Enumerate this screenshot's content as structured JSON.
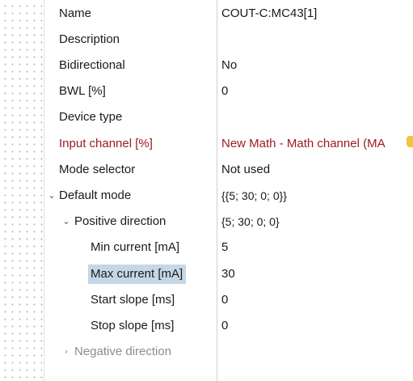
{
  "properties": [
    {
      "name": "Name",
      "value": "COUT-C:MC43[1]"
    },
    {
      "name": "Description",
      "value": ""
    },
    {
      "name": "Bidirectional",
      "value": "No"
    },
    {
      "name": "BWL [%]",
      "value": "0"
    },
    {
      "name": "Device type",
      "value": ""
    },
    {
      "name": "Input channel [%]",
      "value": "New Math - Math channel (MA"
    },
    {
      "name": "Mode selector",
      "value": "Not used"
    },
    {
      "name": "Default mode",
      "value": "{{5; 30; 0; 0}}"
    },
    {
      "name": "Positive direction",
      "value": "{5; 30; 0; 0}"
    },
    {
      "name": "Min current [mA]",
      "value": "5"
    },
    {
      "name": "Max current [mA]",
      "value": "30"
    },
    {
      "name": "Start slope [ms]",
      "value": "0"
    },
    {
      "name": "Stop slope [ms]",
      "value": "0"
    },
    {
      "name": "Negative direction",
      "value": ""
    }
  ],
  "selected_row": "Max current [mA]",
  "colors": {
    "error_text": "#9b1b23",
    "selection": "#c5d7e6",
    "warning": "#f3c33a"
  },
  "icons": {
    "expanded": "chevron-down-icon",
    "collapsed": "chevron-right-icon",
    "warning": "warning-icon"
  }
}
